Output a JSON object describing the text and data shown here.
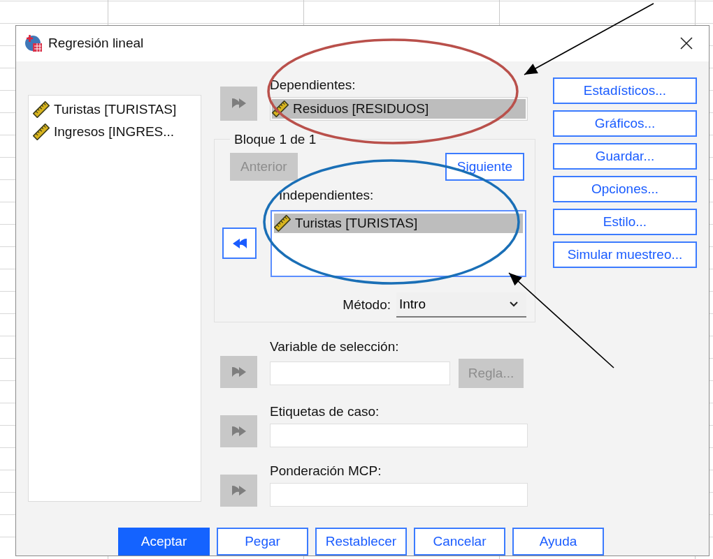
{
  "window": {
    "title": "Regresión lineal"
  },
  "variables": [
    {
      "label": "Turistas [TURISTAS]"
    },
    {
      "label": "Ingresos [INGRES..."
    }
  ],
  "dependents": {
    "label": "Dependientes:",
    "arrow_disabled": true,
    "items": [
      {
        "label": "Residuos [RESIDUOS]",
        "selected": true
      }
    ]
  },
  "block": {
    "title": "Bloque 1 de 1",
    "previous": {
      "label": "Anterior",
      "disabled": true
    },
    "next": {
      "label": "Siguiente",
      "disabled": false
    },
    "independents": {
      "label": "Independientes:",
      "arrow_disabled": false,
      "items": [
        {
          "label": "Turistas [TURISTAS]",
          "selected": true
        }
      ]
    },
    "method": {
      "label": "Método:",
      "value": "Intro"
    }
  },
  "fields": [
    {
      "label": "Variable de selección:",
      "arrow_disabled": true,
      "rule": {
        "label": "Regla...",
        "disabled": true
      }
    },
    {
      "label": "Etiquetas de caso:",
      "arrow_disabled": true
    },
    {
      "label": "Ponderación MCP:",
      "arrow_disabled": true
    }
  ],
  "side_buttons": [
    {
      "label": "Estadísticos..."
    },
    {
      "label": "Gráficos..."
    },
    {
      "label": "Guardar..."
    },
    {
      "label": "Opciones..."
    },
    {
      "label": "Estilo..."
    },
    {
      "label": "Simular muestreo..."
    }
  ],
  "footer_buttons": [
    {
      "label": "Aceptar",
      "default": true
    },
    {
      "label": "Pegar",
      "default": false
    },
    {
      "label": "Restablecer",
      "default": false
    },
    {
      "label": "Cancelar",
      "default": false
    },
    {
      "label": "Ayuda",
      "default": false
    }
  ],
  "annotations": [
    {
      "kind": "ellipse",
      "color": "#b9504b"
    },
    {
      "kind": "ellipse",
      "color": "#1a6fb6"
    },
    {
      "kind": "arrow"
    },
    {
      "kind": "arrow"
    }
  ]
}
